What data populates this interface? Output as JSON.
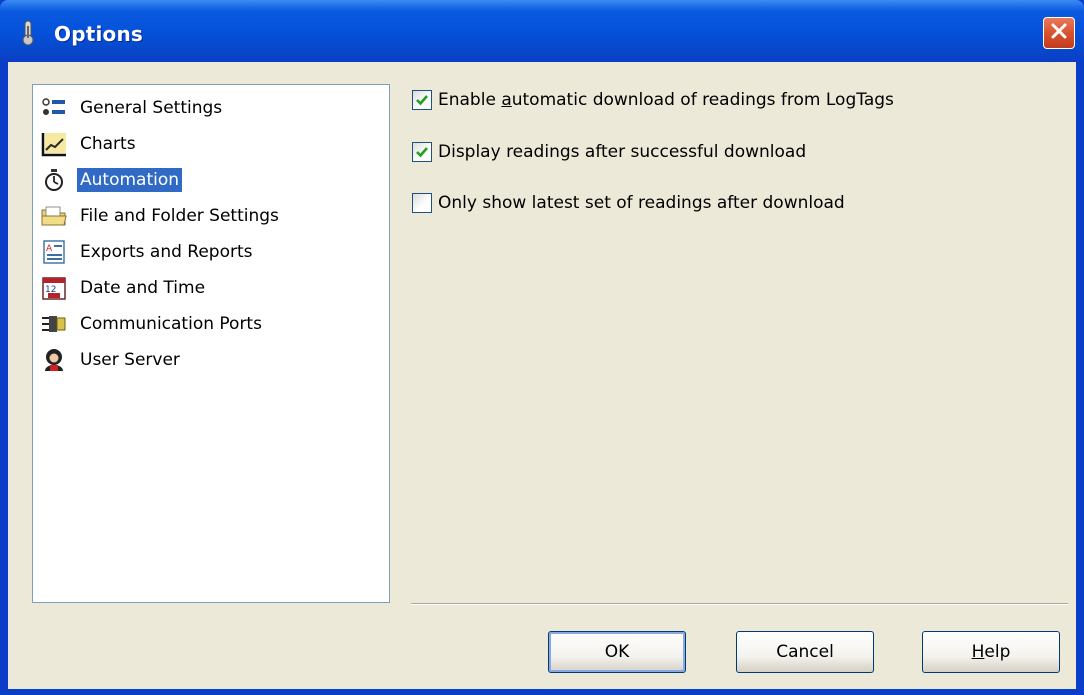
{
  "window": {
    "title": "Options",
    "close_icon": "close-icon"
  },
  "tree": {
    "items": [
      {
        "label": "General Settings",
        "icon": "settings-list-icon",
        "selected": false
      },
      {
        "label": "Charts",
        "icon": "chart-icon",
        "selected": false
      },
      {
        "label": "Automation",
        "icon": "stopwatch-icon",
        "selected": true
      },
      {
        "label": "File and Folder Settings",
        "icon": "folder-icon",
        "selected": false
      },
      {
        "label": "Exports and Reports",
        "icon": "report-icon",
        "selected": false
      },
      {
        "label": "Date and Time",
        "icon": "calendar-icon",
        "selected": false
      },
      {
        "label": "Communication Ports",
        "icon": "port-icon",
        "selected": false
      },
      {
        "label": "User Server",
        "icon": "user-icon",
        "selected": false
      }
    ]
  },
  "options": {
    "auto_download": {
      "label_pre": "Enable ",
      "label_accel": "a",
      "label_post": "utomatic download of readings from LogTags",
      "checked": true
    },
    "display_after": {
      "label": "Display readings after successful download",
      "checked": true
    },
    "latest_only": {
      "label": "Only show latest set of readings after download",
      "checked": false
    }
  },
  "buttons": {
    "ok": "OK",
    "cancel": "Cancel",
    "help_accel": "H",
    "help_rest": "elp"
  },
  "colors": {
    "titlebar": "#0550d9",
    "selection": "#316ac5",
    "dialog_bg": "#ece9d8",
    "close": "#d9532f"
  }
}
